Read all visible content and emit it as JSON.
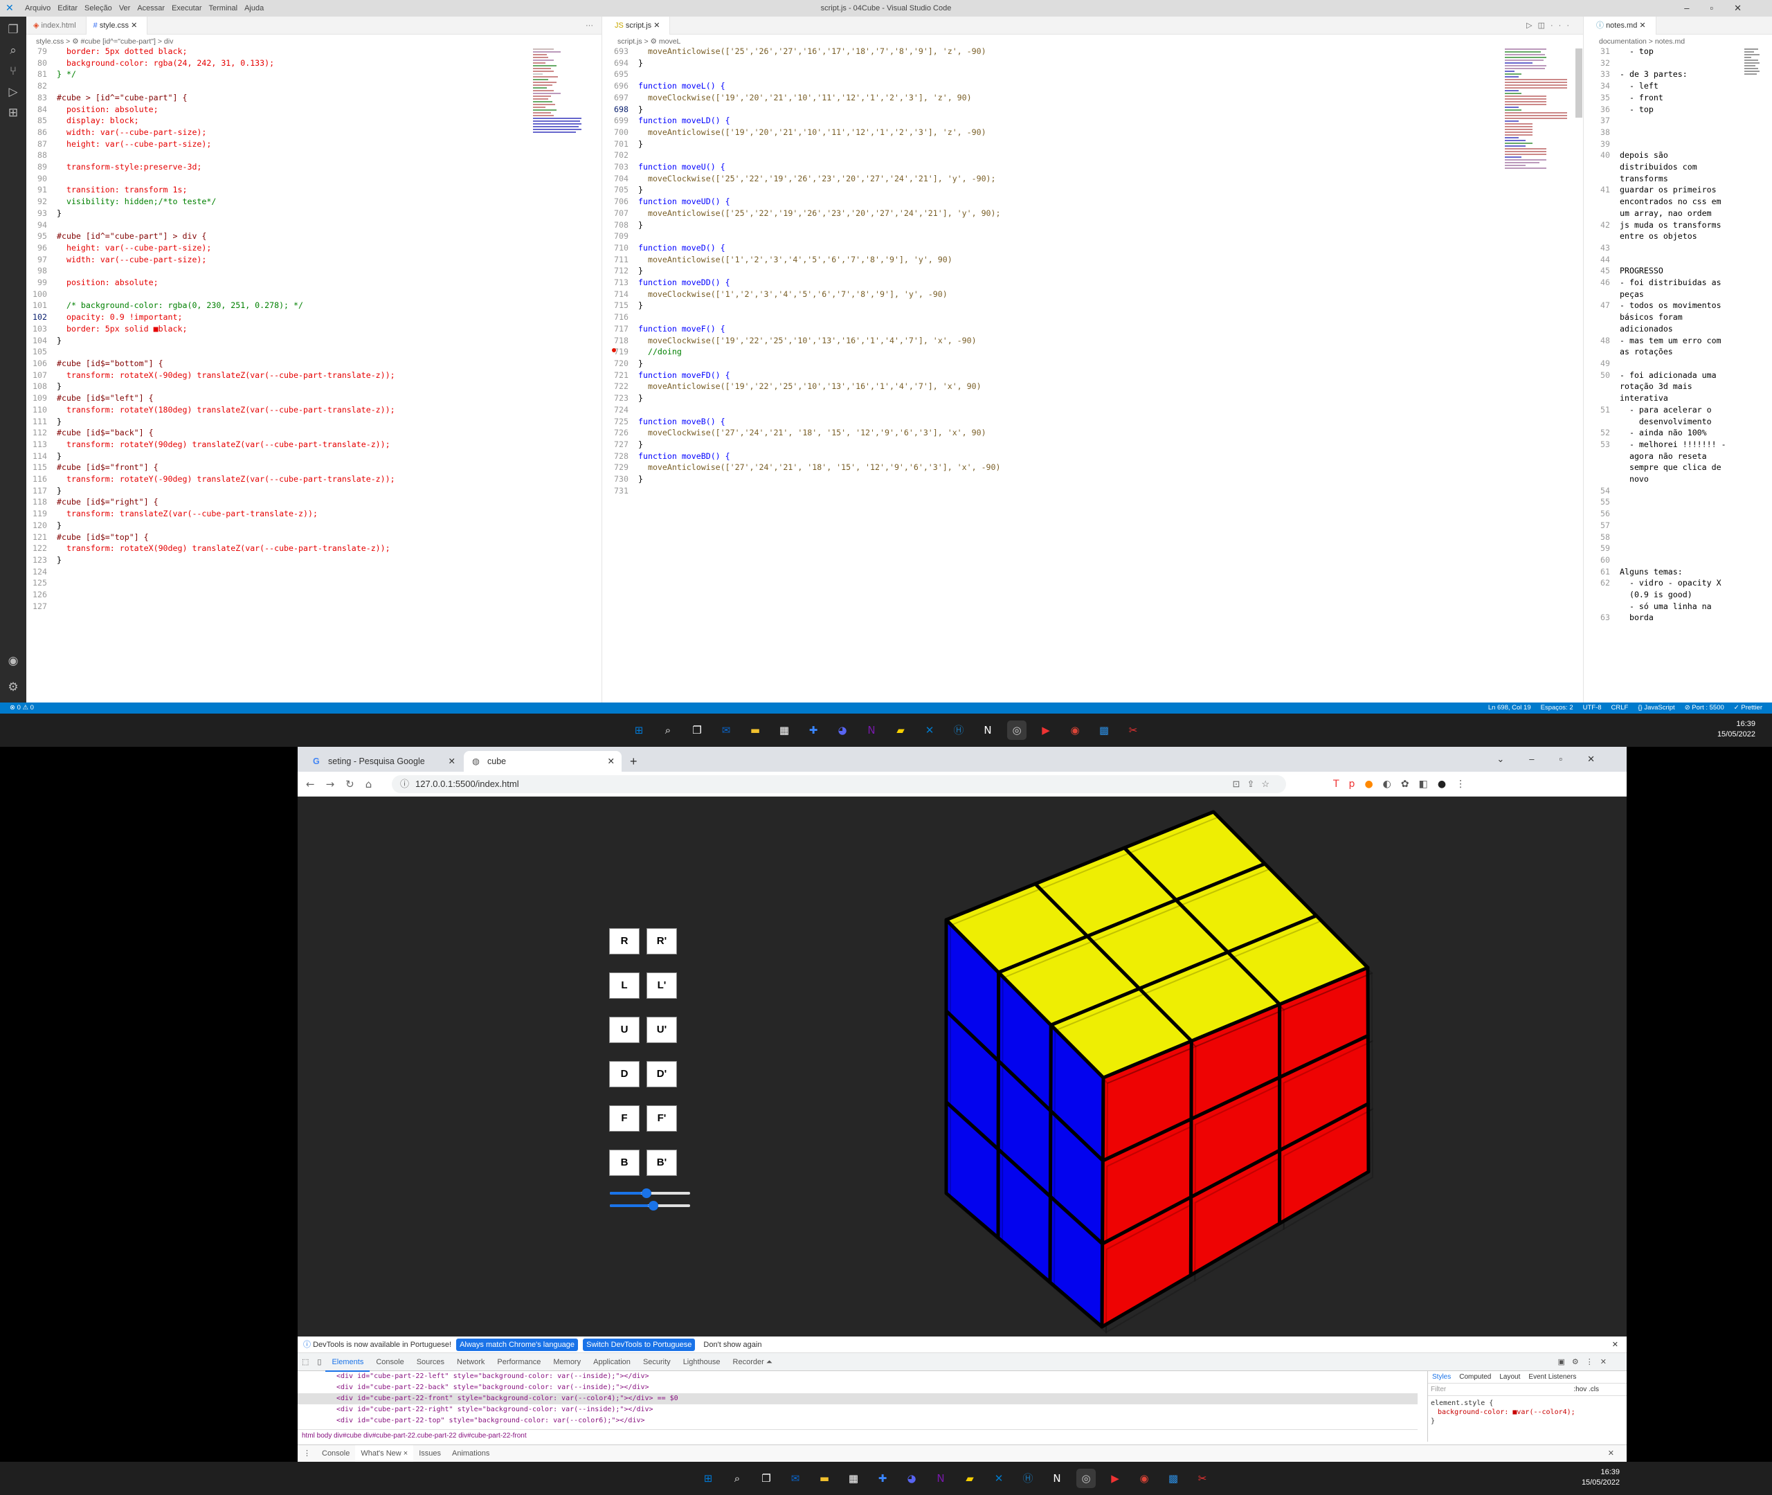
{
  "vscode": {
    "title": "script.js - 04Cube - Visual Studio Code",
    "menu": [
      "Arquivo",
      "Editar",
      "Seleção",
      "Ver",
      "Acessar",
      "Executar",
      "Terminal",
      "Ajuda"
    ],
    "left_tabs": [
      "index.html",
      "style.css"
    ],
    "left_breadcrumb": "style.css > ⚙ #cube [id^=\"cube-part\"] > div",
    "mid_tabs": [
      "script.js"
    ],
    "mid_breadcrumb": "script.js > ⚙ moveL",
    "right_tabs": [
      "notes.md"
    ],
    "right_breadcrumb": "documentation > notes.md",
    "css_lines": [
      {
        "n": "79",
        "t": "  border: 5px dotted black;"
      },
      {
        "n": "80",
        "t": "  background-color: rgba(24, 242, 31, 0.133);"
      },
      {
        "n": "81",
        "t": "} */"
      },
      {
        "n": "82",
        "t": ""
      },
      {
        "n": "83",
        "t": "#cube > [id^=\"cube-part\"] {"
      },
      {
        "n": "84",
        "t": "  position: absolute;"
      },
      {
        "n": "85",
        "t": "  display: block;"
      },
      {
        "n": "86",
        "t": "  width: var(--cube-part-size);"
      },
      {
        "n": "87",
        "t": "  height: var(--cube-part-size);"
      },
      {
        "n": "88",
        "t": ""
      },
      {
        "n": "89",
        "t": "  transform-style:preserve-3d;"
      },
      {
        "n": "90",
        "t": ""
      },
      {
        "n": "91",
        "t": "  transition: transform 1s;"
      },
      {
        "n": "92",
        "t": "  visibility: hidden;/*to teste*/"
      },
      {
        "n": "93",
        "t": "}"
      },
      {
        "n": "94",
        "t": ""
      },
      {
        "n": "95",
        "t": "#cube [id^=\"cube-part\"] > div {"
      },
      {
        "n": "96",
        "t": "  height: var(--cube-part-size);"
      },
      {
        "n": "97",
        "t": "  width: var(--cube-part-size);"
      },
      {
        "n": "98",
        "t": ""
      },
      {
        "n": "99",
        "t": "  position: absolute;"
      },
      {
        "n": "100",
        "t": ""
      },
      {
        "n": "101",
        "t": "  /* background-color: rgba(0, 230, 251, 0.278); */"
      },
      {
        "n": "102",
        "t": "  opacity: 0.9 !important;"
      },
      {
        "n": "103",
        "t": "  border: 5px solid ■black;"
      },
      {
        "n": "104",
        "t": "}"
      },
      {
        "n": "105",
        "t": ""
      },
      {
        "n": "106",
        "t": "#cube [id$=\"bottom\"] {"
      },
      {
        "n": "107",
        "t": "  transform: rotateX(-90deg) translateZ(var(--cube-part-translate-z));"
      },
      {
        "n": "108",
        "t": "}"
      },
      {
        "n": "109",
        "t": "#cube [id$=\"left\"] {"
      },
      {
        "n": "110",
        "t": "  transform: rotateY(180deg) translateZ(var(--cube-part-translate-z));"
      },
      {
        "n": "111",
        "t": "}"
      },
      {
        "n": "112",
        "t": "#cube [id$=\"back\"] {"
      },
      {
        "n": "113",
        "t": "  transform: rotateY(90deg) translateZ(var(--cube-part-translate-z));"
      },
      {
        "n": "114",
        "t": "}"
      },
      {
        "n": "115",
        "t": "#cube [id$=\"front\"] {"
      },
      {
        "n": "116",
        "t": "  transform: rotateY(-90deg) translateZ(var(--cube-part-translate-z));"
      },
      {
        "n": "117",
        "t": "}"
      },
      {
        "n": "118",
        "t": "#cube [id$=\"right\"] {"
      },
      {
        "n": "119",
        "t": "  transform: translateZ(var(--cube-part-translate-z));"
      },
      {
        "n": "120",
        "t": "}"
      },
      {
        "n": "121",
        "t": "#cube [id$=\"top\"] {"
      },
      {
        "n": "122",
        "t": "  transform: rotateX(90deg) translateZ(var(--cube-part-translate-z));"
      },
      {
        "n": "123",
        "t": "}"
      },
      {
        "n": "124",
        "t": ""
      },
      {
        "n": "125",
        "t": ""
      },
      {
        "n": "126",
        "t": ""
      },
      {
        "n": "127",
        "t": ""
      }
    ],
    "js_lines": [
      {
        "n": "693",
        "t": "  moveAnticlowise(['25','26','27','16','17','18','7','8','9'], 'z', -90)"
      },
      {
        "n": "694",
        "t": "}"
      },
      {
        "n": "695",
        "t": ""
      },
      {
        "n": "696",
        "t": "function moveL() {"
      },
      {
        "n": "697",
        "t": "  moveClockwise(['19','20','21','10','11','12','1','2','3'], 'z', 90)"
      },
      {
        "n": "698",
        "t": "}"
      },
      {
        "n": "699",
        "t": "function moveLD() {"
      },
      {
        "n": "700",
        "t": "  moveAnticlowise(['19','20','21','10','11','12','1','2','3'], 'z', -90)"
      },
      {
        "n": "701",
        "t": "}"
      },
      {
        "n": "702",
        "t": ""
      },
      {
        "n": "703",
        "t": "function moveU() {"
      },
      {
        "n": "704",
        "t": "  moveClockwise(['25','22','19','26','23','20','27','24','21'], 'y', -90);"
      },
      {
        "n": "705",
        "t": "}"
      },
      {
        "n": "706",
        "t": "function moveUD() {"
      },
      {
        "n": "707",
        "t": "  moveAnticlowise(['25','22','19','26','23','20','27','24','21'], 'y', 90);"
      },
      {
        "n": "708",
        "t": "}"
      },
      {
        "n": "709",
        "t": ""
      },
      {
        "n": "710",
        "t": "function moveD() {"
      },
      {
        "n": "711",
        "t": "  moveAnticlowise(['1','2','3','4','5','6','7','8','9'], 'y', 90)"
      },
      {
        "n": "712",
        "t": "}"
      },
      {
        "n": "713",
        "t": "function moveDD() {"
      },
      {
        "n": "714",
        "t": "  moveClockwise(['1','2','3','4','5','6','7','8','9'], 'y', -90)"
      },
      {
        "n": "715",
        "t": "}"
      },
      {
        "n": "716",
        "t": ""
      },
      {
        "n": "717",
        "t": "function moveF() {"
      },
      {
        "n": "718",
        "t": "  moveClockwise(['19','22','25','10','13','16','1','4','7'], 'x', -90)"
      },
      {
        "n": "719",
        "t": "  //doing"
      },
      {
        "n": "720",
        "t": "}"
      },
      {
        "n": "721",
        "t": "function moveFD() {"
      },
      {
        "n": "722",
        "t": "  moveAnticlowise(['19','22','25','10','13','16','1','4','7'], 'x', 90)"
      },
      {
        "n": "723",
        "t": "}"
      },
      {
        "n": "724",
        "t": ""
      },
      {
        "n": "725",
        "t": "function moveB() {"
      },
      {
        "n": "726",
        "t": "  moveClockwise(['27','24','21', '18', '15', '12','9','6','3'], 'x', 90)"
      },
      {
        "n": "727",
        "t": "}"
      },
      {
        "n": "728",
        "t": "function moveBD() {"
      },
      {
        "n": "729",
        "t": "  moveAnticlowise(['27','24','21', '18', '15', '12','9','6','3'], 'x', -90)"
      },
      {
        "n": "730",
        "t": "}"
      },
      {
        "n": "731",
        "t": ""
      }
    ],
    "notes_lines": [
      {
        "n": "31",
        "t": "  - top"
      },
      {
        "n": "32",
        "t": ""
      },
      {
        "n": "33",
        "t": "- de 3 partes:"
      },
      {
        "n": "34",
        "t": "  - left"
      },
      {
        "n": "35",
        "t": "  - front"
      },
      {
        "n": "36",
        "t": "  - top"
      },
      {
        "n": "37",
        "t": ""
      },
      {
        "n": "38",
        "t": ""
      },
      {
        "n": "39",
        "t": ""
      },
      {
        "n": "40",
        "t": "depois são"
      },
      {
        "n": "",
        "t": "distribuidos com"
      },
      {
        "n": "",
        "t": "transforms"
      },
      {
        "n": "41",
        "t": "guardar os primeiros"
      },
      {
        "n": "",
        "t": "encontrados no css em"
      },
      {
        "n": "",
        "t": "um array, nao ordem"
      },
      {
        "n": "42",
        "t": "js muda os transforms"
      },
      {
        "n": "",
        "t": "entre os objetos"
      },
      {
        "n": "43",
        "t": ""
      },
      {
        "n": "44",
        "t": ""
      },
      {
        "n": "45",
        "t": "PROGRESSO"
      },
      {
        "n": "46",
        "t": "- foi distribuidas as"
      },
      {
        "n": "",
        "t": "peças"
      },
      {
        "n": "47",
        "t": "- todos os movimentos"
      },
      {
        "n": "",
        "t": "básicos foram"
      },
      {
        "n": "",
        "t": "adicionados"
      },
      {
        "n": "48",
        "t": "- mas tem um erro com"
      },
      {
        "n": "",
        "t": "as rotações"
      },
      {
        "n": "49",
        "t": ""
      },
      {
        "n": "50",
        "t": "- foi adicionada uma"
      },
      {
        "n": "",
        "t": "rotação 3d mais"
      },
      {
        "n": "",
        "t": "interativa"
      },
      {
        "n": "51",
        "t": "  - para acelerar o"
      },
      {
        "n": "",
        "t": "    desenvolvimento"
      },
      {
        "n": "52",
        "t": "  - ainda não 100%"
      },
      {
        "n": "53",
        "t": "  - melhorei !!!!!!! -"
      },
      {
        "n": "",
        "t": "  agora não reseta"
      },
      {
        "n": "",
        "t": "  sempre que clica de"
      },
      {
        "n": "",
        "t": "  novo"
      },
      {
        "n": "54",
        "t": ""
      },
      {
        "n": "55",
        "t": ""
      },
      {
        "n": "56",
        "t": ""
      },
      {
        "n": "57",
        "t": ""
      },
      {
        "n": "58",
        "t": ""
      },
      {
        "n": "59",
        "t": ""
      },
      {
        "n": "60",
        "t": ""
      },
      {
        "n": "61",
        "t": "Alguns temas:"
      },
      {
        "n": "62",
        "t": "  - vidro - opacity X"
      },
      {
        "n": "",
        "t": "  (0.9 is good)"
      },
      {
        "n": "",
        "t": "  - só uma linha na"
      },
      {
        "n": "63",
        "t": "  borda"
      }
    ],
    "status_left": "⊗ 0 ⚠ 0",
    "status_right": [
      "Ln 698, Col 19",
      "Espaços: 2",
      "UTF-8",
      "CRLF",
      "{} JavaScript",
      "⊘ Port : 5500",
      "✓ Prettier"
    ]
  },
  "taskbar": {
    "time": "16:39",
    "date": "15/05/2022",
    "icons": [
      "windows-start",
      "search",
      "task-view",
      "mail",
      "file-explorer",
      "store",
      "vs-code-blue",
      "discord",
      "onenote",
      "sticky-notes",
      "vs-code",
      "hydra",
      "notion",
      "chrome-dev",
      "media",
      "chrome",
      "photos",
      "snipping"
    ]
  },
  "chrome": {
    "tabs": [
      {
        "title": "seting - Pesquisa Google",
        "icon": "google-icon"
      },
      {
        "title": "cube",
        "icon": "globe-icon"
      }
    ],
    "url": "127.0.0.1:5500/index.html"
  },
  "page": {
    "buttons": [
      [
        "R",
        "R'"
      ],
      [
        "L",
        "L'"
      ],
      [
        "U",
        "U'"
      ],
      [
        "D",
        "D'"
      ],
      [
        "F",
        "F'"
      ],
      [
        "B",
        "B'"
      ]
    ],
    "sliders": [
      0.45,
      0.55
    ],
    "cube_colors": {
      "top": "#ffff00",
      "front": "#ff0000",
      "left": "#0000ff"
    }
  },
  "devtools": {
    "info": "DevTools is now available in Portuguese!",
    "btn_match": "Always match Chrome's language",
    "btn_switch": "Switch DevTools to Portuguese",
    "btn_dont": "Don't show again",
    "tabs": [
      "Elements",
      "Console",
      "Sources",
      "Network",
      "Performance",
      "Memory",
      "Application",
      "Security",
      "Lighthouse",
      "Recorder ⏶"
    ],
    "dom_rows": [
      "<div id=\"cube-part-22-left\" style=\"background-color: var(--inside);\"></div>",
      "<div id=\"cube-part-22-back\" style=\"background-color: var(--inside);\"></div>",
      "<div id=\"cube-part-22-front\" style=\"background-color: var(--color4);\"></div> == $0",
      "<div id=\"cube-part-22-right\" style=\"background-color: var(--inside);\"></div>",
      "<div id=\"cube-part-22-top\" style=\"background-color: var(--color6);\"></div>"
    ],
    "dom_crumbs": "html  body  div#cube  div#cube-part-22.cube-part-22  div#cube-part-22-front",
    "styles_tabs": [
      "Styles",
      "Computed",
      "Layout",
      "Event Listeners"
    ],
    "filter": "Filter",
    "hov": ":hov  .cls",
    "element_style": "element.style {",
    "style_prop": "background-color: ■var(--color4);",
    "bottom_tabs": [
      "Console",
      "What's New ×",
      "Issues",
      "Animations"
    ]
  }
}
